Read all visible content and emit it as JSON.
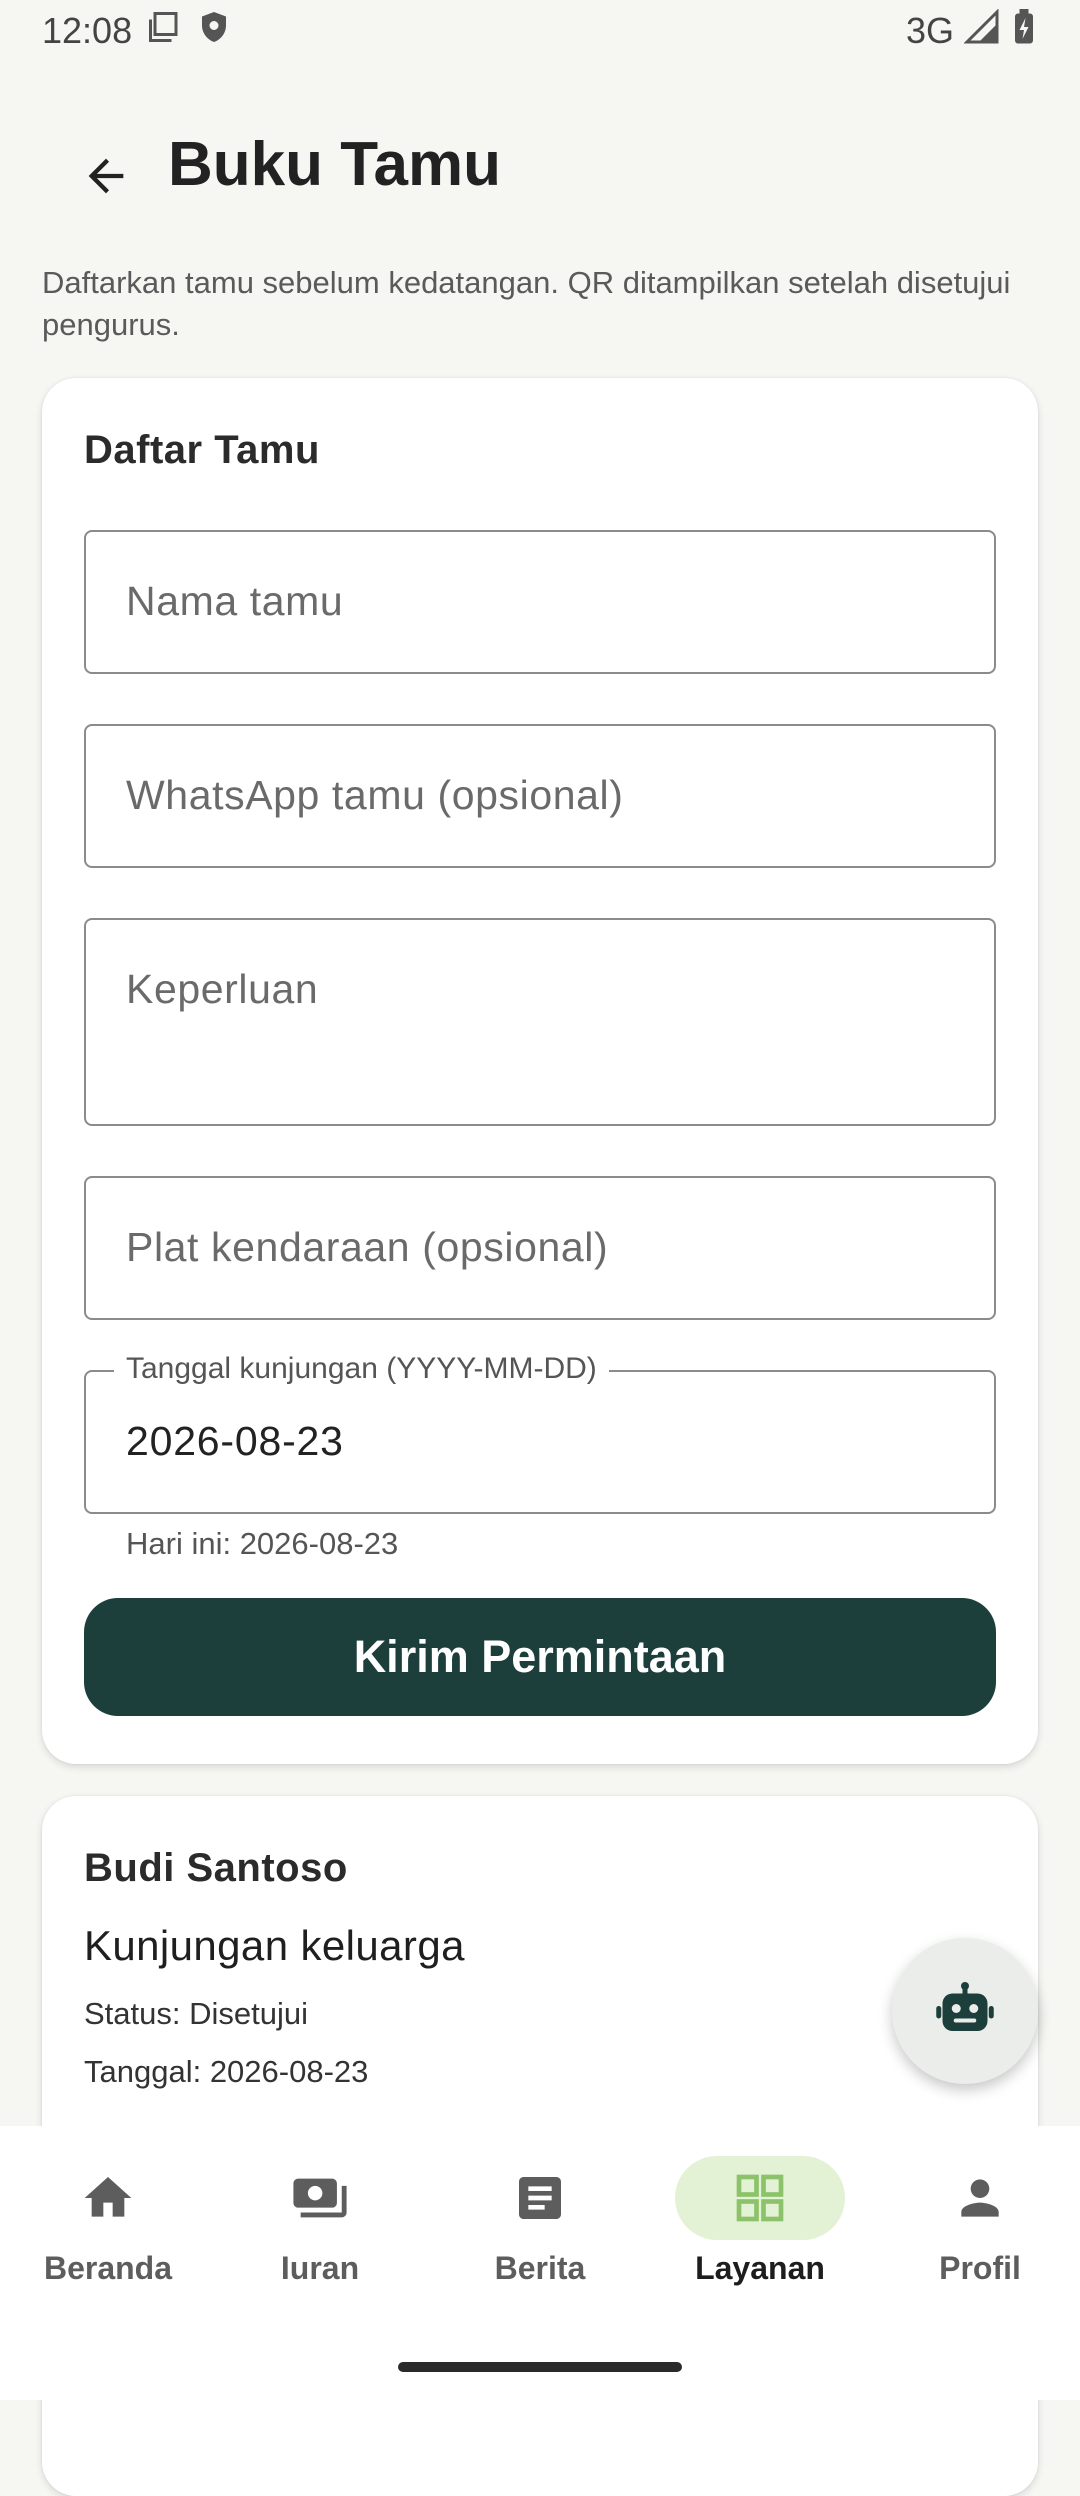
{
  "status_bar": {
    "time": "12:08",
    "network": "3G"
  },
  "header": {
    "title": "Buku Tamu"
  },
  "subtitle": "Daftarkan tamu sebelum kedatangan. QR ditampilkan setelah disetujui pengurus.",
  "form": {
    "title": "Daftar Tamu",
    "name_placeholder": "Nama tamu",
    "whatsapp_placeholder": "WhatsApp tamu (opsional)",
    "purpose_placeholder": "Keperluan",
    "plate_placeholder": "Plat kendaraan (opsional)",
    "date_label": "Tanggal kunjungan (YYYY-MM-DD)",
    "date_value": "2026-08-23",
    "date_helper": "Hari ini: 2026-08-23",
    "submit_label": "Kirim Permintaan"
  },
  "guest_list": [
    {
      "name": "Budi Santoso",
      "purpose": "Kunjungan keluarga",
      "status": "Status: Disetujui",
      "date": "Tanggal: 2026-08-23"
    }
  ],
  "nav": {
    "items": [
      {
        "label": "Beranda",
        "icon": "home-icon"
      },
      {
        "label": "Iuran",
        "icon": "payments-icon"
      },
      {
        "label": "Berita",
        "icon": "article-icon"
      },
      {
        "label": "Layanan",
        "icon": "grid-icon",
        "active": true
      },
      {
        "label": "Profil",
        "icon": "person-icon"
      }
    ]
  },
  "colors": {
    "primary": "#1c3f3c",
    "nav_active_bg": "#e3f1d4",
    "nav_active_icon": "#8cc36a",
    "background": "#f6f6f3"
  }
}
